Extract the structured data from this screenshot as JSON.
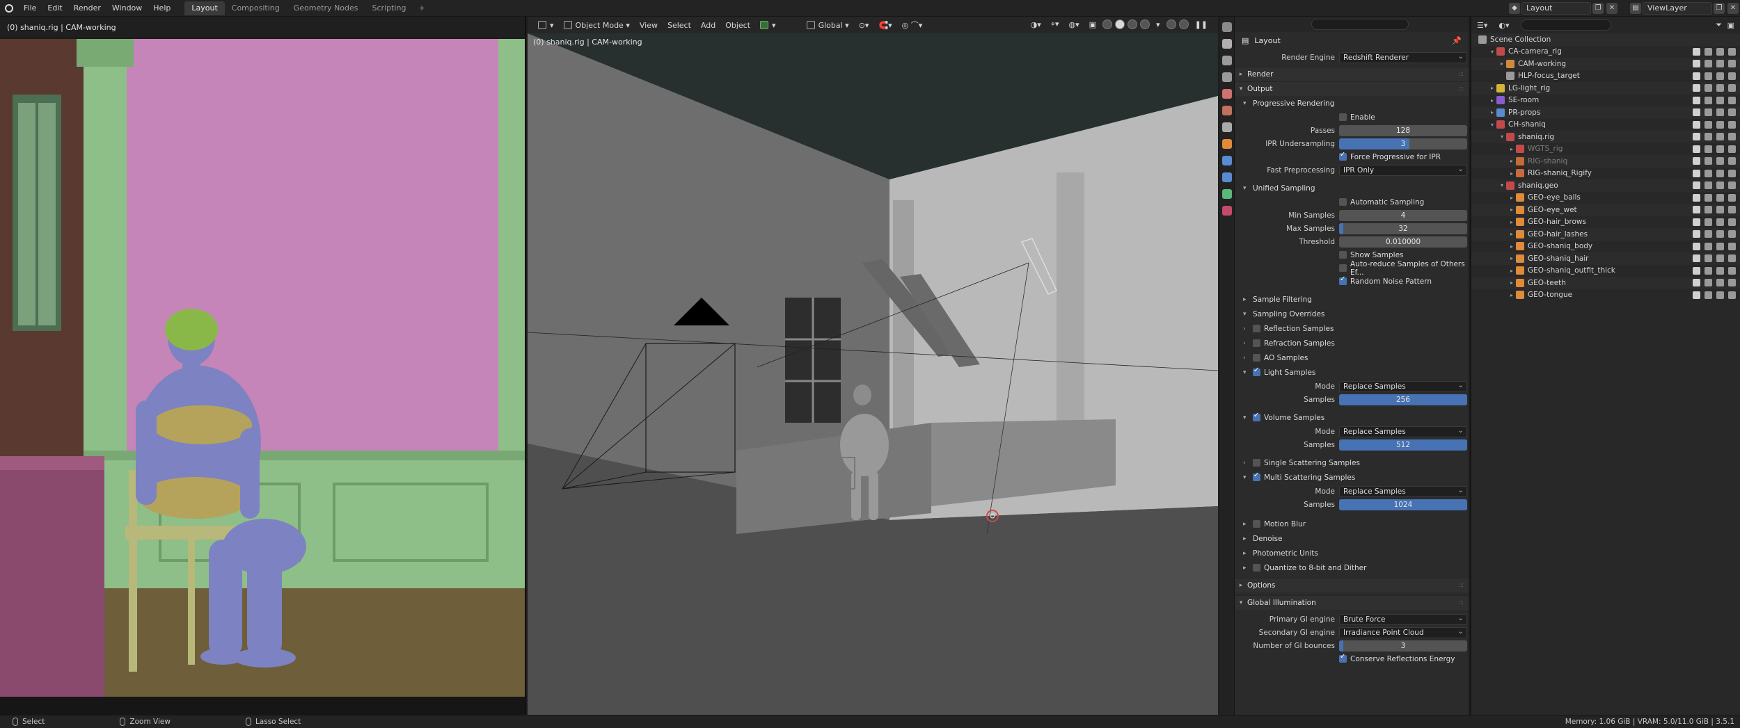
{
  "topbar": {
    "menus": [
      "File",
      "Edit",
      "Render",
      "Window",
      "Help"
    ],
    "workspaces": [
      "Layout",
      "Compositing",
      "Geometry Nodes",
      "Scripting"
    ],
    "active_workspace": "Layout",
    "add_tab": "+",
    "scene_name": "Layout",
    "view_layer": "ViewLayer"
  },
  "left_viewport": {
    "label": "(0) shaniq.rig | CAM-working"
  },
  "center_viewport": {
    "label": "(0) shaniq.rig | CAM-working",
    "toolbar": {
      "mode": "Object Mode",
      "menus": [
        "View",
        "Select",
        "Add",
        "Object"
      ],
      "orientation": "Global"
    }
  },
  "properties": {
    "title": "Layout",
    "render_engine_label": "Render Engine",
    "render_engine": "Redshift Renderer",
    "panels": {
      "render": "Render",
      "output": "Output",
      "progressive": "Progressive Rendering",
      "enable": "Enable",
      "passes_label": "Passes",
      "passes": "128",
      "ipr_label": "IPR Undersampling",
      "ipr": "3",
      "force_prog": "Force Progressive for IPR",
      "fast_pre_label": "Fast Preprocessing",
      "fast_pre": "IPR Only",
      "unified": "Unified Sampling",
      "auto_sampling": "Automatic Sampling",
      "min_label": "Min Samples",
      "min": "4",
      "max_label": "Max Samples",
      "max": "32",
      "thresh_label": "Threshold",
      "thresh": "0.010000",
      "show_samples": "Show Samples",
      "auto_reduce": "Auto-reduce Samples of Others Ef...",
      "random_noise": "Random Noise Pattern",
      "sample_filtering": "Sample Filtering",
      "sampling_overrides": "Sampling Overrides",
      "reflection": "Reflection Samples",
      "refraction": "Refraction Samples",
      "ao": "AO Samples",
      "light": "Light Samples",
      "mode_label": "Mode",
      "samples_label": "Samples",
      "replace": "Replace Samples",
      "light_samples": "256",
      "volume": "Volume Samples",
      "volume_samples": "512",
      "single_scatter": "Single Scattering Samples",
      "multi_scatter": "Multi Scattering Samples",
      "multi_samples": "1024",
      "motion_blur": "Motion Blur",
      "denoise": "Denoise",
      "photometric": "Photometric Units",
      "quantize": "Quantize to 8-bit and Dither",
      "options": "Options",
      "gi": "Global Illumination",
      "primary_label": "Primary GI engine",
      "primary": "Brute Force",
      "secondary_label": "Secondary GI engine",
      "secondary": "Irradiance Point Cloud",
      "bounces_label": "Number of GI bounces",
      "bounces": "3",
      "conserve": "Conserve Reflections Energy"
    }
  },
  "outliner": {
    "root": "Scene Collection",
    "rows": [
      {
        "name": "CA-camera_rig",
        "indent": 1,
        "arrow": "▾",
        "color": "#c24a4a",
        "dim": false
      },
      {
        "name": "CAM-working",
        "indent": 2,
        "arrow": "▸",
        "color": "#d08a3a",
        "dim": false
      },
      {
        "name": "HLP-focus_target",
        "indent": 2,
        "arrow": "",
        "color": "#9a9a9a",
        "dim": false
      },
      {
        "name": "LG-light_rig",
        "indent": 1,
        "arrow": "▸",
        "color": "#d4b43a",
        "dim": false
      },
      {
        "name": "SE-room",
        "indent": 1,
        "arrow": "▸",
        "color": "#8a5ad0",
        "dim": false
      },
      {
        "name": "PR-props",
        "indent": 1,
        "arrow": "▸",
        "color": "#5a8ad0",
        "dim": false
      },
      {
        "name": "CH-shaniq",
        "indent": 1,
        "arrow": "▾",
        "color": "#c24a4a",
        "dim": false
      },
      {
        "name": "shaniq.rig",
        "indent": 2,
        "arrow": "▾",
        "color": "#c24a4a",
        "dim": false
      },
      {
        "name": "WGTS_rig",
        "indent": 3,
        "arrow": "▸",
        "color": "#c24a4a",
        "dim": true
      },
      {
        "name": "RIG-shaniq",
        "indent": 3,
        "arrow": "▸",
        "color": "#c86a3a",
        "dim": true
      },
      {
        "name": "RIG-shaniq_Rigify",
        "indent": 3,
        "arrow": "▸",
        "color": "#c86a3a",
        "dim": false
      },
      {
        "name": "shaniq.geo",
        "indent": 2,
        "arrow": "▾",
        "color": "#c24a4a",
        "dim": false
      },
      {
        "name": "GEO-eye_balls",
        "indent": 3,
        "arrow": "▸",
        "color": "#e08a3a",
        "dim": false
      },
      {
        "name": "GEO-eye_wet",
        "indent": 3,
        "arrow": "▸",
        "color": "#e08a3a",
        "dim": false
      },
      {
        "name": "GEO-hair_brows",
        "indent": 3,
        "arrow": "▸",
        "color": "#e08a3a",
        "dim": false
      },
      {
        "name": "GEO-hair_lashes",
        "indent": 3,
        "arrow": "▸",
        "color": "#e08a3a",
        "dim": false
      },
      {
        "name": "GEO-shaniq_body",
        "indent": 3,
        "arrow": "▸",
        "color": "#e08a3a",
        "dim": false
      },
      {
        "name": "GEO-shaniq_hair",
        "indent": 3,
        "arrow": "▸",
        "color": "#e08a3a",
        "dim": false
      },
      {
        "name": "GEO-shaniq_outfit_thick",
        "indent": 3,
        "arrow": "▸",
        "color": "#e08a3a",
        "dim": false
      },
      {
        "name": "GEO-teeth",
        "indent": 3,
        "arrow": "▸",
        "color": "#e08a3a",
        "dim": false
      },
      {
        "name": "GEO-tongue",
        "indent": 3,
        "arrow": "▸",
        "color": "#e08a3a",
        "dim": false
      }
    ]
  },
  "statusbar": {
    "select": "Select",
    "zoom": "Zoom View",
    "lasso": "Lasso Select",
    "memory": "Memory: 1.06 GiB | VRAM: 5.0/11.0 GiB | 3.5.1"
  },
  "colors": {
    "accent": "#4772b3",
    "wall_pink": "#c585b8",
    "trim_green": "#8fbf88",
    "floor": "#6e5e3a",
    "body_blue": "#7d82c2",
    "outfit_gold": "#b5a35c"
  }
}
